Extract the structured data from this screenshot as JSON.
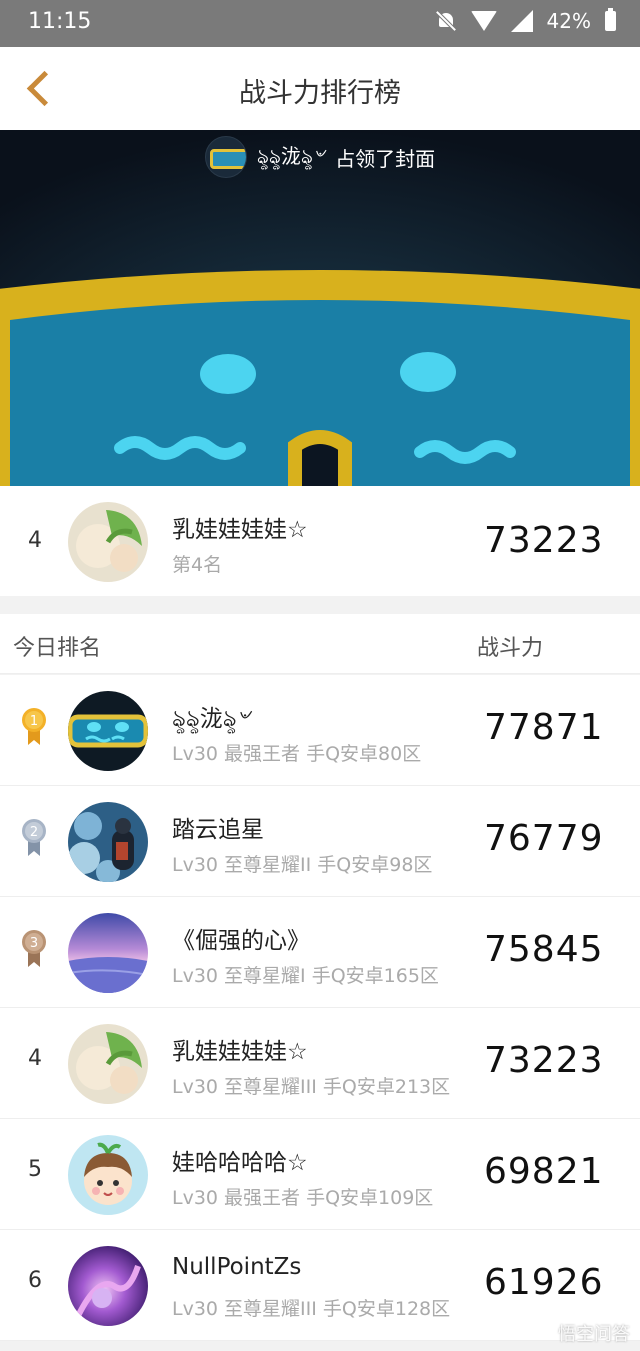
{
  "status_bar": {
    "time": "11:15",
    "battery": "42%"
  },
  "nav": {
    "title": "战斗力排行榜"
  },
  "cover": {
    "owner": "ৡৡ泷ৡ৺",
    "caption": "占领了封面"
  },
  "my_rank": {
    "rank": "4",
    "name": "乳娃娃娃娃☆",
    "sub": "第4名",
    "score": "73223"
  },
  "header": {
    "left": "今日排名",
    "right": "战斗力"
  },
  "rows": [
    {
      "rank": "1",
      "name": "ৡৡ泷ৡ৺",
      "sub": "Lv30 最强王者 手Q安卓80区",
      "score": "77871"
    },
    {
      "rank": "2",
      "name": "踏云追星",
      "sub": "Lv30 至尊星耀II 手Q安卓98区",
      "score": "76779"
    },
    {
      "rank": "3",
      "name": "《倔强的心》",
      "sub": "Lv30 至尊星耀I 手Q安卓165区",
      "score": "75845"
    },
    {
      "rank": "4",
      "name": "乳娃娃娃娃☆",
      "sub": "Lv30 至尊星耀III 手Q安卓213区",
      "score": "73223"
    },
    {
      "rank": "5",
      "name": "娃哈哈哈哈☆",
      "sub": "Lv30 最强王者 手Q安卓109区",
      "score": "69821"
    },
    {
      "rank": "6",
      "name": "NullPointZs",
      "sub": "Lv30 至尊星耀III 手Q安卓128区",
      "score": "61926"
    }
  ],
  "watermark": "悟空问答",
  "colors": {
    "accent": "#c98a3a",
    "gold": "#f3b128",
    "silver": "#a7b4c6",
    "bronze": "#b99374"
  }
}
